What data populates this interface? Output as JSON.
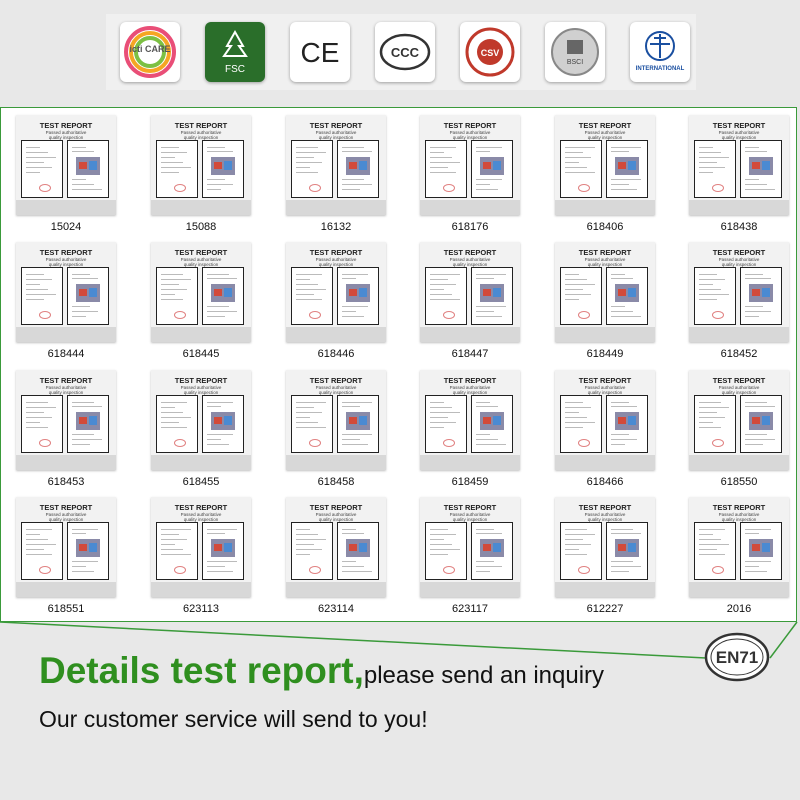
{
  "logos": [
    {
      "name": "icti-care-logo",
      "text": "icti CARE"
    },
    {
      "name": "fsc-logo",
      "text": "FSC"
    },
    {
      "name": "ce-logo",
      "text": "CE"
    },
    {
      "name": "ccc-logo",
      "text": "CCC"
    },
    {
      "name": "csv-logo",
      "text": "CSV"
    },
    {
      "name": "bsci-logo",
      "text": "BSCI"
    },
    {
      "name": "astm-logo",
      "text": "INTERNATIONAL"
    }
  ],
  "report_card": {
    "heading": "TEST REPORT",
    "sub1": "Passed authoritative",
    "sub2": "quality inspection"
  },
  "reports": [
    "15024",
    "15088",
    "16132",
    "618176",
    "618406",
    "618438",
    "618444",
    "618445",
    "618446",
    "618447",
    "618449",
    "618452",
    "618453",
    "618455",
    "618458",
    "618459",
    "618466",
    "618550",
    "618551",
    "623113",
    "623114",
    "623117",
    "612227",
    "2016"
  ],
  "headline": {
    "big": "Details test report,",
    "small": "please send an inquiry"
  },
  "subline": "Our customer service will send to you!",
  "badge": "EN71",
  "colors": {
    "accent": "#2f8f1f",
    "border": "#3a9a3a"
  }
}
